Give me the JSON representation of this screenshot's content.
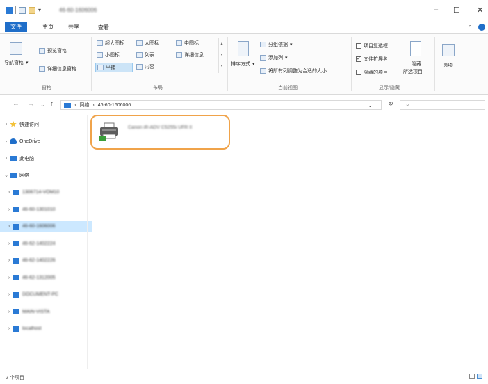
{
  "window": {
    "title": "46-60-1606006",
    "controls": {
      "minimize": "–",
      "maximize": "☐",
      "close": "✕"
    }
  },
  "tabs": [
    {
      "label": "文件"
    },
    {
      "label": "主页"
    },
    {
      "label": "共享"
    },
    {
      "label": "查看"
    }
  ],
  "ribbon": {
    "panes": {
      "nav_pane": "导航窗格",
      "preview_pane": "预览窗格",
      "details_pane": "详细信息窗格",
      "label": "窗格"
    },
    "layout": {
      "items": [
        "超大图标",
        "大图标",
        "中图标",
        "小图标",
        "列表",
        "详细信息",
        "平铺",
        "内容"
      ],
      "selected": "平铺",
      "label": "布局"
    },
    "current_view": {
      "sort_by": "排序方式",
      "group_by": "分组依据",
      "add_columns": "添加列",
      "size_all_columns": "将所有列调整为合适的大小",
      "label": "当前视图"
    },
    "show_hide": {
      "item_checkboxes": "项目复选框",
      "file_extensions": "文件扩展名",
      "hidden_items": "隐藏的项目",
      "hide_selected": "隐藏",
      "hide_selected_sub": "所选项目",
      "options": "选项",
      "label": "显示/隐藏"
    }
  },
  "address": {
    "network": "网络",
    "computer": "46-60-1606006",
    "dropdown": "⌄",
    "refresh": "↻"
  },
  "nav": {
    "back": "←",
    "forward": "→",
    "recent": "⌄",
    "up": "↑"
  },
  "nav_tree": [
    {
      "label": "快速访问",
      "chev": "›"
    },
    {
      "label": "OneDrive",
      "chev": "›"
    },
    {
      "label": "此电脑",
      "chev": "›"
    },
    {
      "label": "网络",
      "chev": "⌄"
    },
    {
      "label": "1306714-VOM10",
      "chev": "›"
    },
    {
      "label": "46-60-1301010",
      "chev": "›"
    },
    {
      "label": "46-60-1606006",
      "chev": "›",
      "selected": true
    },
    {
      "label": "46-62-1402224",
      "chev": "›"
    },
    {
      "label": "46-62-1402226",
      "chev": "›"
    },
    {
      "label": "46-62-1312005",
      "chev": "›"
    },
    {
      "label": "DOCUMENT-PC",
      "chev": "›"
    },
    {
      "label": "MAIN-VISTA",
      "chev": "›"
    },
    {
      "label": "localhost",
      "chev": "›"
    }
  ],
  "content": {
    "printer_name": "Canon iR-ADV C5255i UFR II"
  },
  "status": {
    "item_count": "2 个项目"
  },
  "colors": {
    "accent": "#1f6ec9",
    "highlight": "#f0a34a",
    "selected_bg": "#cce8ff"
  }
}
